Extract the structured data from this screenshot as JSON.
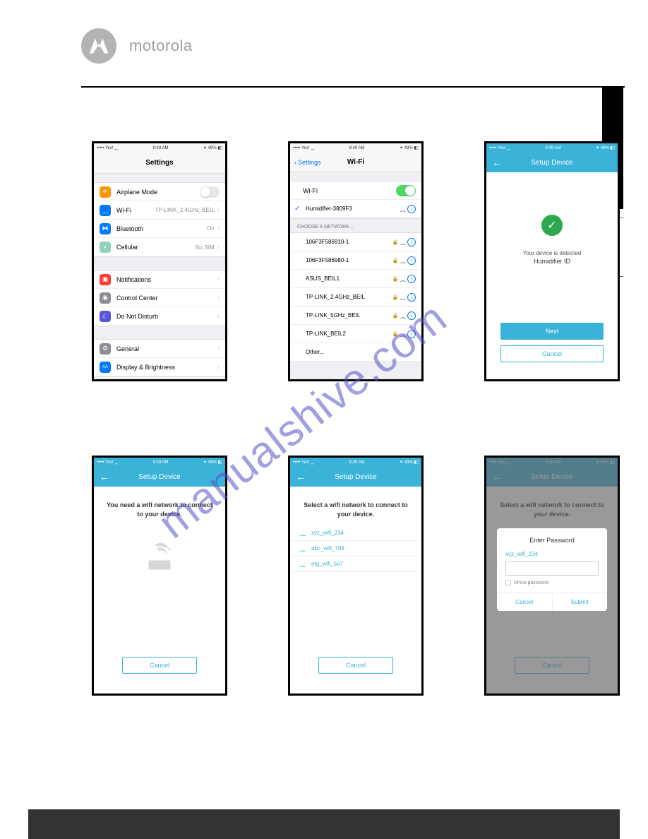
{
  "brand": "motorola",
  "watermark": "manualshive.com",
  "status": {
    "carrier": "••••• Yes! ⁔",
    "time": "9:49 AM",
    "battery": "⁕ 49% ▮▯"
  },
  "screen1": {
    "title": "Settings",
    "rows": [
      {
        "icon_color": "#ff9500",
        "glyph": "✈",
        "label": "Airplane Mode",
        "toggle": false
      },
      {
        "icon_color": "#007aff",
        "glyph": "⁔",
        "label": "Wi-Fi",
        "value": "TP-LINK_2.4GHz_BEIL"
      },
      {
        "icon_color": "#007aff",
        "glyph": "⧓",
        "label": "Bluetooth",
        "value": "On"
      },
      {
        "icon_color": "#8fd3b8",
        "glyph": "▮",
        "label": "Cellular",
        "value": "No SIM"
      }
    ],
    "rows2": [
      {
        "icon_color": "#ff3b30",
        "glyph": "▣",
        "label": "Notifications"
      },
      {
        "icon_color": "#8e8e93",
        "glyph": "◉",
        "label": "Control Center"
      },
      {
        "icon_color": "#5856d6",
        "glyph": "☾",
        "label": "Do Not Disturb"
      }
    ],
    "rows3": [
      {
        "icon_color": "#8e8e93",
        "glyph": "⚙",
        "label": "General"
      },
      {
        "icon_color": "#007aff",
        "glyph": "ᴬA",
        "label": "Display & Brightness"
      }
    ]
  },
  "screen2": {
    "back": "Settings",
    "title": "Wi-Fi",
    "wifi_label": "Wi-Fi",
    "connected": "Humidifier-3809F3",
    "choose_label": "CHOOSE A NETWORK...",
    "networks": [
      "106F3F586910-1",
      "106F3F586980-1",
      "ASUS_BEIL1",
      "TP-LINK_2.4GHz_BEIL",
      "TP-LINK_5GHz_BEIL",
      "TP-LINK_BEIL2"
    ],
    "other": "Other..."
  },
  "screen3": {
    "title": "Setup Device",
    "msg1": "Your device is detected",
    "msg2": "Humidifier ID",
    "next": "Next",
    "cancel": "Cancel"
  },
  "screen4": {
    "title": "Setup Device",
    "prompt": "You need a wifi network to connect to your device.",
    "cancel": "Cancel"
  },
  "screen5": {
    "title": "Setup Device",
    "prompt": "Select a wifi network to connect to your device.",
    "networks": [
      "xyz_wifi_234",
      "abc_wifi_789",
      "efg_wifi_567"
    ],
    "cancel": "Cancel"
  },
  "screen6": {
    "title": "Setup Device",
    "prompt": "Select a wifi network to connect to your device.",
    "dialog_title": "Enter Password",
    "dialog_ssid": "xyz_wifi_234",
    "show_pw": "Show password",
    "cancel": "Cancel",
    "submit": "Submit",
    "bg_cancel": "Cancel"
  }
}
